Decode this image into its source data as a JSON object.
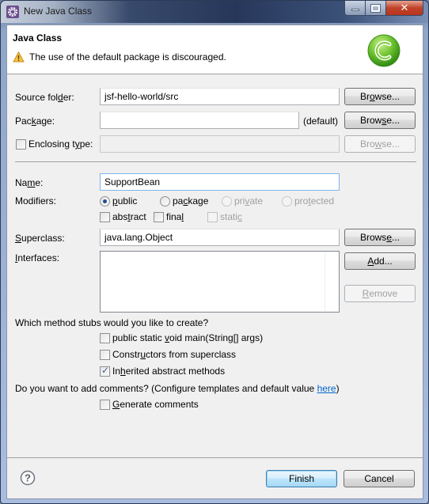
{
  "window": {
    "title": "New Java Class",
    "controls": [
      "minimize",
      "maximize",
      "close"
    ]
  },
  "header": {
    "title": "Java Class",
    "message": "The use of the default package is discouraged.",
    "message_icon": "warning-icon",
    "logo_icon": "java-class-c-icon",
    "logo_color": "#5cb82b"
  },
  "form": {
    "source_folder": {
      "label_pre": "Source fol",
      "label_u": "d",
      "label_post": "er:",
      "value": "jsf-hello-world/src",
      "browse": {
        "pre": "Br",
        "u": "o",
        "post": "wse..."
      }
    },
    "package": {
      "label_pre": "Pac",
      "label_u": "k",
      "label_post": "age:",
      "value": "",
      "hint": "(default)",
      "browse": {
        "pre": "Brow",
        "u": "s",
        "post": "e..."
      }
    },
    "enclosing_type": {
      "label_pre": "Enclosing t",
      "label_u": "y",
      "label_post": "pe:",
      "checked": false,
      "value": "",
      "browse": {
        "pre": "Bro",
        "u": "w",
        "post": "se..."
      }
    },
    "name": {
      "label_pre": "Na",
      "label_u": "m",
      "label_post": "e:",
      "value": "SupportBean"
    },
    "modifiers": {
      "label": "Modifiers:",
      "access": [
        {
          "pre": "",
          "u": "p",
          "post": "ublic",
          "selected": true,
          "enabled": true
        },
        {
          "pre": "pa",
          "u": "c",
          "post": "kage",
          "selected": false,
          "enabled": true
        },
        {
          "pre": "pri",
          "u": "v",
          "post": "ate",
          "selected": false,
          "enabled": false
        },
        {
          "pre": "pro",
          "u": "t",
          "post": "ected",
          "selected": false,
          "enabled": false
        }
      ],
      "flags": [
        {
          "pre": "abs",
          "u": "t",
          "post": "ract",
          "checked": false,
          "enabled": true
        },
        {
          "pre": "fina",
          "u": "l",
          "post": "",
          "checked": false,
          "enabled": true
        },
        {
          "pre": "stati",
          "u": "c",
          "post": "",
          "checked": false,
          "enabled": false
        }
      ]
    },
    "superclass": {
      "label_pre": "",
      "label_u": "S",
      "label_post": "uperclass:",
      "value": "java.lang.Object",
      "browse": {
        "pre": "Brows",
        "u": "e",
        "post": "..."
      }
    },
    "interfaces": {
      "label_pre": "",
      "label_u": "I",
      "label_post": "nterfaces:",
      "items": [],
      "add": {
        "pre": "",
        "u": "A",
        "post": "dd..."
      },
      "remove": {
        "pre": "",
        "u": "R",
        "post": "emove"
      }
    },
    "stubs": {
      "question": "Which method stubs would you like to create?",
      "options": [
        {
          "pre": "public static ",
          "u": "v",
          "post": "oid main(String[] args)",
          "checked": false
        },
        {
          "pre": "Constr",
          "u": "u",
          "post": "ctors from superclass",
          "checked": false
        },
        {
          "pre": "In",
          "u": "h",
          "post": "erited abstract methods",
          "checked": true
        }
      ]
    },
    "comments": {
      "question_pre": "Do you want to add comments? (Configure templates and default value ",
      "link": "here",
      "question_post": ")",
      "option": {
        "pre": "",
        "u": "G",
        "post": "enerate comments",
        "checked": false
      }
    }
  },
  "footer": {
    "help_icon": "help-icon",
    "finish": "Finish",
    "cancel": "Cancel"
  }
}
